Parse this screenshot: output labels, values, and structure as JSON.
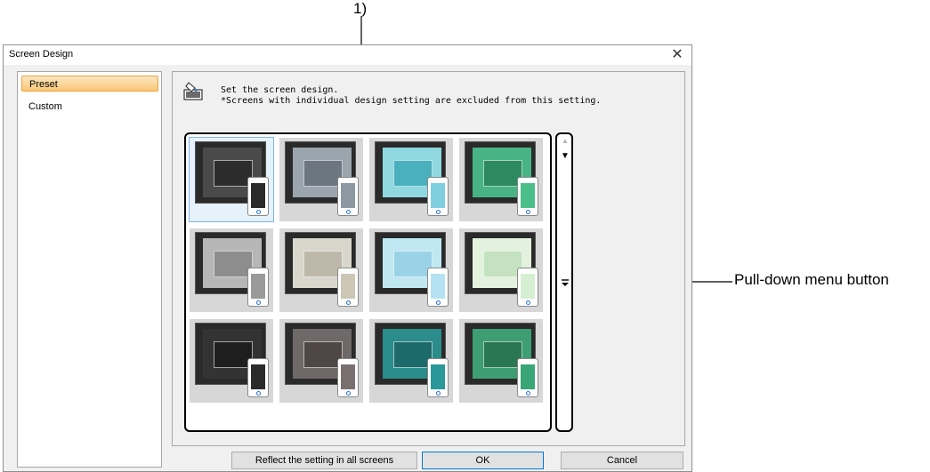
{
  "dialog": {
    "title": "Screen Design",
    "close_glyph": "✕",
    "nav": [
      {
        "label": "Preset",
        "selected": true
      },
      {
        "label": "Custom",
        "selected": false
      }
    ],
    "description": {
      "line1": "Set the screen design.",
      "line2": "*Screens with individual design setting are excluded from this setting.",
      "icon": "paint-bucket-icon"
    },
    "thumbnails": [
      {
        "bg": "#4a4a4a",
        "win": "#2c2c2c",
        "phone": "#2a2a2a",
        "selected": true
      },
      {
        "bg": "#9aa5ad",
        "win": "#6b7680",
        "phone": "#8c98a2",
        "selected": false
      },
      {
        "bg": "#8fd8e0",
        "win": "#4bb0be",
        "phone": "#7fcfe0",
        "selected": false
      },
      {
        "bg": "#48b486",
        "win": "#2d8a60",
        "phone": "#4bbf8a",
        "selected": false
      },
      {
        "bg": "#b6b6b6",
        "win": "#8d8d8d",
        "phone": "#9a9a9a",
        "selected": false
      },
      {
        "bg": "#d9d6cc",
        "win": "#bdb8aa",
        "phone": "#cbc6b5",
        "selected": false
      },
      {
        "bg": "#bfe8f3",
        "win": "#9ad3e6",
        "phone": "#b4e2f2",
        "selected": false
      },
      {
        "bg": "#e3f2df",
        "win": "#c5e2c0",
        "phone": "#d6eed2",
        "selected": false
      },
      {
        "bg": "#333333",
        "win": "#1e1e1e",
        "phone": "#2b2b2b",
        "selected": false
      },
      {
        "bg": "#6f6868",
        "win": "#4f4747",
        "phone": "#7a6f6f",
        "selected": false
      },
      {
        "bg": "#2b8c8c",
        "win": "#1d6a6a",
        "phone": "#2a9898",
        "selected": false
      },
      {
        "bg": "#3c9e72",
        "win": "#2a7754",
        "phone": "#3aa678",
        "selected": false
      }
    ],
    "buttons": {
      "reflect": "Reflect the setting in all screens",
      "ok": "OK",
      "cancel": "Cancel"
    },
    "scrollbar": {
      "up": "▲",
      "down": "▼"
    }
  },
  "callouts": {
    "label_1": "1)",
    "pulldown": "Pull-down menu button"
  }
}
